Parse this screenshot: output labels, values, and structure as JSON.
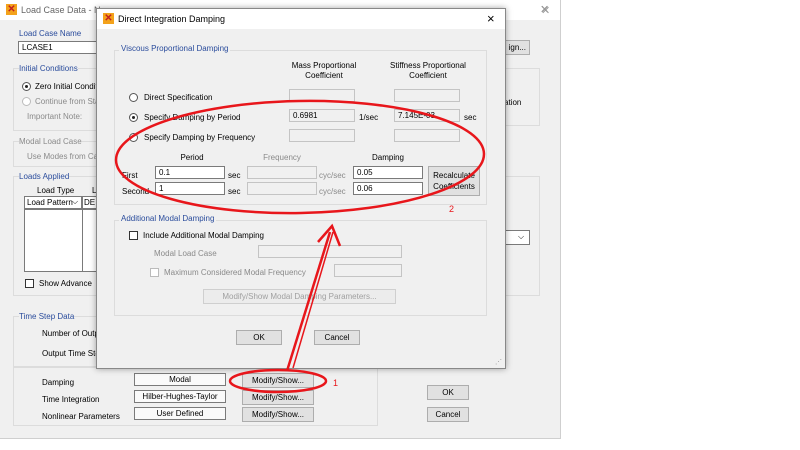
{
  "bg": {
    "title": "Load Case Data - N",
    "load_case_name_label": "Load Case Name",
    "load_case_name_value": "LCASE1",
    "design_btn": "ign...",
    "initial_conditions_label": "Initial Conditions",
    "zero_initial": "Zero Initial Conditi",
    "continue_from": "Continue from Stat",
    "important_note": "Important Note:",
    "modal_load_case_label": "Modal Load Case",
    "use_modes": "Use Modes from Cas",
    "loads_applied_label": "Loads Applied",
    "load_type_header": "Load Type",
    "load_name_header": "L",
    "load_pattern_value": "Load Pattern",
    "load_name_value": "DE",
    "show_advanced": "Show Advance",
    "right_label_1": "ation",
    "time_step_label": "Time Step Data",
    "number_of_output": "Number of Outp",
    "output_time_step": "Output Time Ste",
    "damping_label": "Damping",
    "damping_value": "Modal",
    "damping_btn": "Modify/Show...",
    "time_integration_label": "Time Integration",
    "time_integration_value": "Hilber-Hughes-Taylor",
    "time_integration_btn": "Modify/Show...",
    "nonlinear_label": "Nonlinear Parameters",
    "nonlinear_value": "User Defined",
    "nonlinear_btn": "Modify/Show...",
    "ok": "OK",
    "cancel": "Cancel"
  },
  "dialog": {
    "title": "Direct Integration Damping",
    "close": "×",
    "viscous_label": "Viscous Proportional Damping",
    "mass_header": "Mass Proportional\nCoefficient",
    "stiff_header": "Stiffness Proportional\nCoefficient",
    "direct_spec": "Direct Specification",
    "by_period": "Specify Damping by Period",
    "by_frequency": "Specify Damping by Frequency",
    "mass_value": "0.6981",
    "mass_unit": "1/sec",
    "stiff_value": "7.145E-03",
    "stiff_unit": "sec",
    "period_header": "Period",
    "frequency_header": "Frequency",
    "damping_header": "Damping",
    "first_label": "First",
    "second_label": "Second",
    "first_period": "0.1",
    "second_period": "1",
    "sec_unit": "sec",
    "cyc_unit": "cyc/sec",
    "first_damping": "0.05",
    "second_damping": "0.06",
    "recalc_btn": "Recalculate\nCoefficients",
    "additional_label": "Additional Modal Damping",
    "include_additional": "Include Additional Modal Damping",
    "modal_load_case": "Modal Load Case",
    "max_modal_freq": "Maximum Considered Modal Frequency",
    "modify_modal_btn": "Modify/Show Modal Damping Parameters...",
    "ok": "OK",
    "cancel": "Cancel"
  },
  "annotations": {
    "label_1": "1",
    "label_2": "2",
    "color": "#e8161b"
  }
}
